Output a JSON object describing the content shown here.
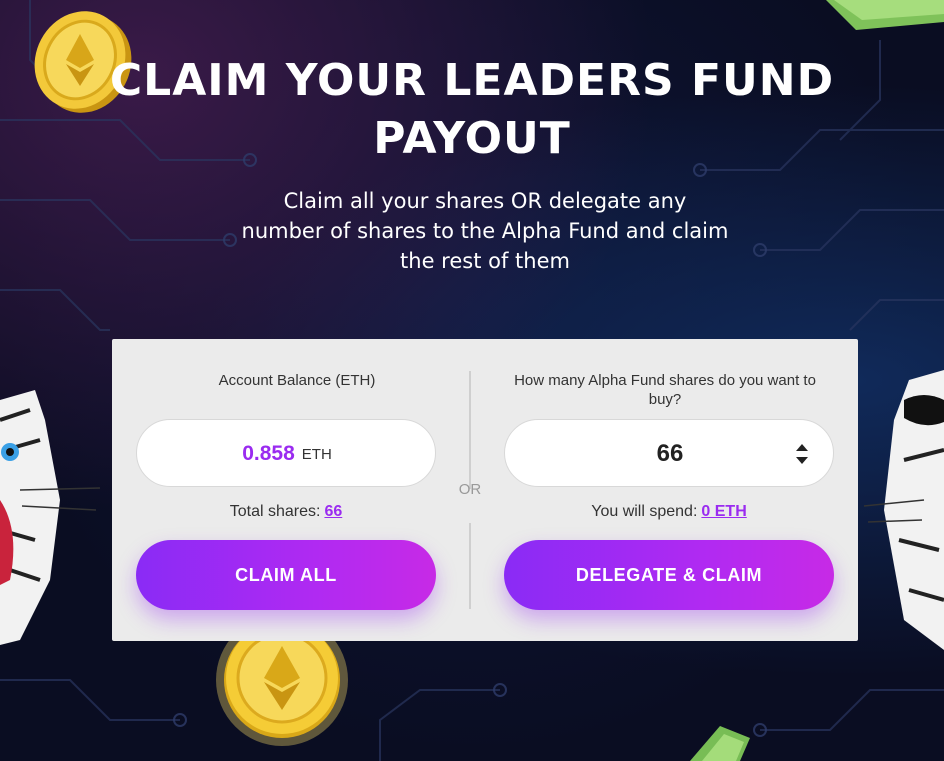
{
  "header": {
    "title_line1": "CLAIM YOUR LEADERS FUND",
    "title_line2": "PAYOUT",
    "subtitle": "Claim all your shares OR delegate any number of shares to the Alpha Fund and claim the rest of them"
  },
  "claim_panel": {
    "balance_label": "Account Balance (ETH)",
    "balance_value": "0.858",
    "balance_unit": "ETH",
    "total_shares_label": "Total shares:",
    "total_shares_value": "66",
    "claim_all_label": "CLAIM ALL"
  },
  "separator": {
    "or_label": "OR"
  },
  "delegate_panel": {
    "question_label": "How many Alpha Fund shares do you want to buy?",
    "shares_input_value": "66",
    "spend_label": "You will spend:",
    "spend_value": "0 ETH",
    "delegate_label": "DELEGATE & CLAIM"
  },
  "icons": {
    "stepper": "up-down-arrows-icon",
    "coin": "ethereum-coin-icon",
    "cash": "banknote-icon",
    "mascot": "white-tiger-mascot"
  },
  "colors": {
    "accent_purple": "#9a2bf0",
    "button_gradient_start": "#8a2bf5",
    "button_gradient_end": "#c72ae6",
    "card_bg": "#ebebeb",
    "page_bg": "#0a0d22"
  }
}
